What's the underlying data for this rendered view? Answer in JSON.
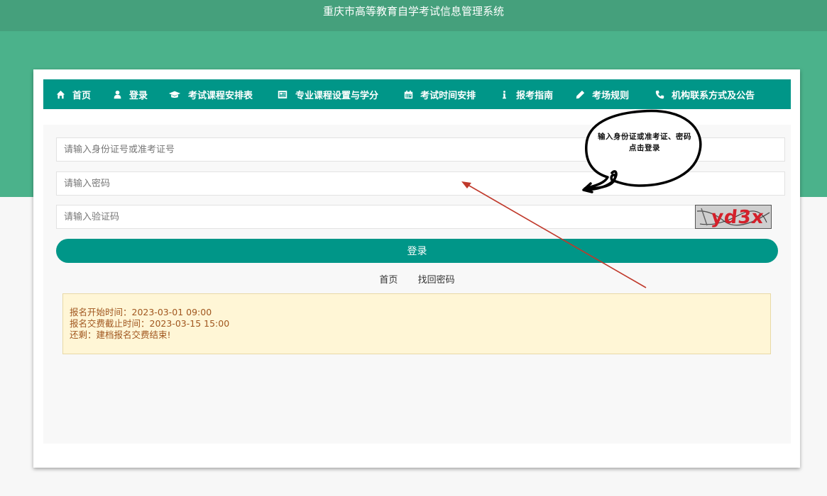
{
  "header": {
    "title": "重庆市高等教育自学考试信息管理系统"
  },
  "nav": {
    "items": [
      {
        "label": "首页",
        "icon": "home-icon"
      },
      {
        "label": "登录",
        "icon": "user-icon"
      },
      {
        "label": "考试课程安排表",
        "icon": "graduation-cap-icon"
      },
      {
        "label": "专业课程设置与学分",
        "icon": "newspaper-icon"
      },
      {
        "label": "考试时间安排",
        "icon": "calendar-icon"
      },
      {
        "label": "报考指南",
        "icon": "info-icon"
      },
      {
        "label": "考场规则",
        "icon": "pencil-icon"
      },
      {
        "label": "机构联系方式及公告",
        "icon": "phone-icon"
      }
    ]
  },
  "form": {
    "id_placeholder": "请输入身份证号或准考证号",
    "password_placeholder": "请输入密码",
    "captcha_placeholder": "请输入验证码",
    "captcha_text": "yd3x",
    "login_label": "登录"
  },
  "links": {
    "home": "首页",
    "recover": "找回密码"
  },
  "notice": {
    "line1": "报名开始时间：2023-03-01 09:00",
    "line2": "报名交费截止时间：2023-03-15 15:00",
    "line3": "还剩：建档报名交费结束!"
  },
  "annotation": {
    "line1": "输入身份证或准考证、密码",
    "line2": "点击登录"
  },
  "colors": {
    "header": "#45a07c",
    "band": "#4bb28b",
    "primary": "#009688",
    "notice_bg": "#fff6d6",
    "notice_text": "#a0561e",
    "arrow": "#c0392b"
  }
}
